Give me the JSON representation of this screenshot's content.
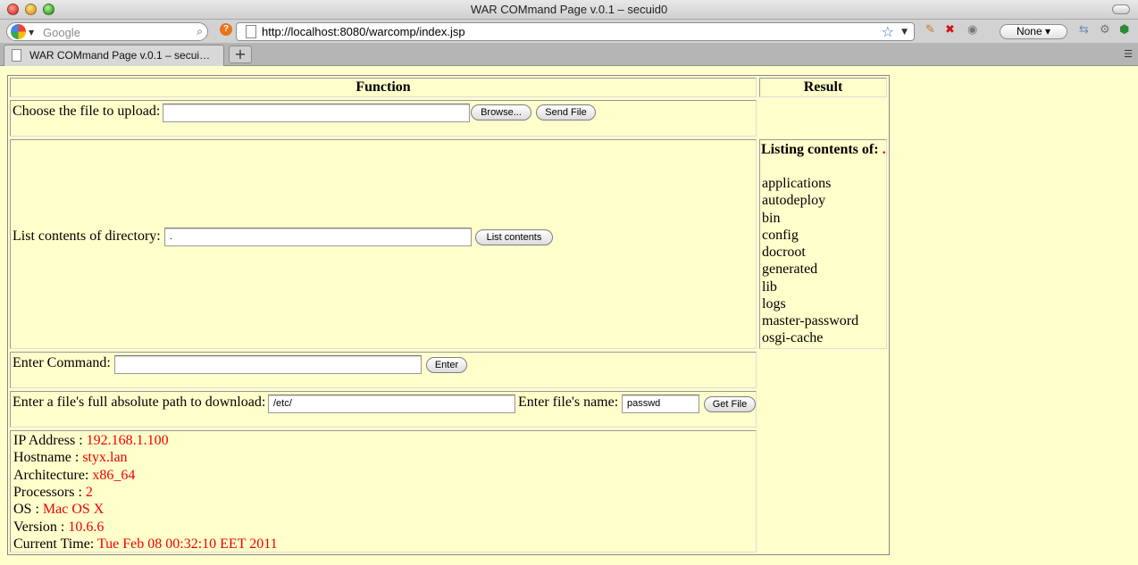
{
  "window": {
    "title": "WAR COMmand Page v.0.1 – secuid0"
  },
  "search": {
    "placeholder": "Google"
  },
  "url_bar": {
    "url": "http://localhost:8080/warcomp/index.jsp"
  },
  "toolbar": {
    "none_label": "None"
  },
  "tabs": [
    {
      "label": "WAR COMmand Page v.0.1 – secui…"
    }
  ],
  "table": {
    "function_header": "Function",
    "result_header": "Result"
  },
  "upload": {
    "label": "Choose the file to upload:",
    "browse_label": "Browse...",
    "send_label": "Send File",
    "file_value": ""
  },
  "list_dir": {
    "label": "List contents of directory:",
    "value": ".",
    "button_label": "List contents"
  },
  "command": {
    "label": "Enter Command:",
    "value": "",
    "button_label": "Enter"
  },
  "download": {
    "path_label": "Enter a file's full absolute path to download:",
    "path_value": "/etc/",
    "name_label": "Enter file's name:",
    "name_value": "passwd",
    "button_label": "Get File"
  },
  "system_info": [
    {
      "label": "IP Address : ",
      "value": "192.168.1.100"
    },
    {
      "label": "Hostname : ",
      "value": "styx.lan"
    },
    {
      "label": "Architecture: ",
      "value": "x86_64"
    },
    {
      "label": "Processors : ",
      "value": "2"
    },
    {
      "label": "OS : ",
      "value": "Mac OS X"
    },
    {
      "label": "Version : ",
      "value": "10.6.6"
    },
    {
      "label": "Current Time: ",
      "value": "Tue Feb 08 00:32:10 EET 2011"
    }
  ],
  "result": {
    "heading": "Listing contents of:",
    "path": ".",
    "items": [
      "applications",
      "autodeploy",
      "bin",
      "config",
      "docroot",
      "generated",
      "lib",
      "logs",
      "master-password",
      "osgi-cache"
    ]
  },
  "colors": {
    "page_background": "#ffffcc",
    "value_red": "#ee0000"
  }
}
